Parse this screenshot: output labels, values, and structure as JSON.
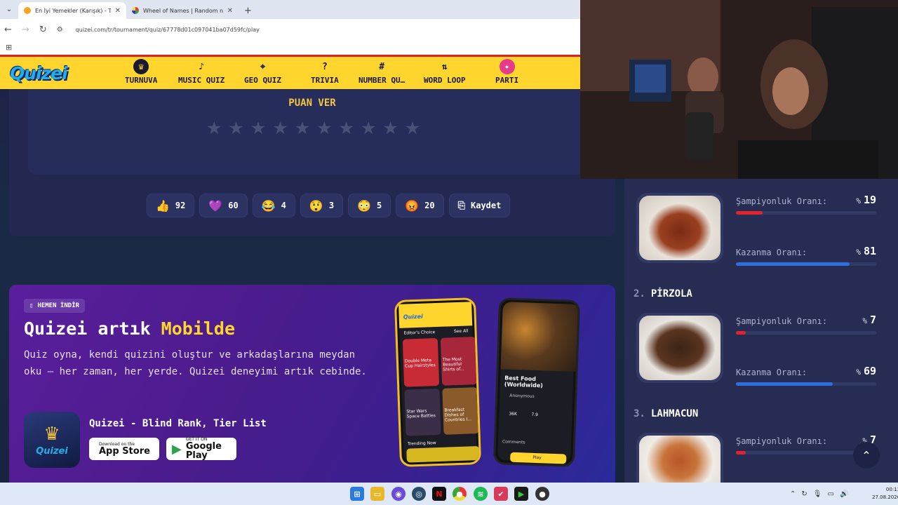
{
  "browser": {
    "tabs": [
      {
        "title": "En İyi Yemekler (Karışık) - Tier Li",
        "active": true
      },
      {
        "title": "Wheel of Names | Random nam",
        "active": false
      }
    ],
    "new_tab": "+",
    "url": "quizei.com/tr/tournament/quiz/67778d01c097041ba07d59fc/play"
  },
  "site": {
    "logo": "Quizei",
    "nav": [
      {
        "label": "TURNUVA",
        "icon": "trophy-icon"
      },
      {
        "label": "MUSIC QUIZ",
        "icon": "music-note-icon"
      },
      {
        "label": "GEO QUIZ",
        "icon": "map-pin-icon"
      },
      {
        "label": "TRIVIA",
        "icon": "question-icon"
      },
      {
        "label": "NUMBER QU…",
        "icon": "hash-icon"
      },
      {
        "label": "WORD LOOP",
        "icon": "sort-icon"
      },
      {
        "label": "PARTI",
        "icon": "party-icon"
      }
    ]
  },
  "rating": {
    "title": "PUAN VER",
    "star_count": 10,
    "selected": 0
  },
  "reactions": [
    {
      "emoji": "👍",
      "count": "92"
    },
    {
      "emoji": "💜",
      "count": "60"
    },
    {
      "emoji": "😂",
      "count": "4"
    },
    {
      "emoji": "😲",
      "count": "3"
    },
    {
      "emoji": "😳",
      "count": "5"
    },
    {
      "emoji": "😡",
      "count": "20"
    }
  ],
  "save_label": "Kaydet",
  "promo": {
    "badge": "HEMEN İNDİR",
    "title_prefix": "Quizei artık ",
    "title_highlight": "Mobilde",
    "description": "Quiz oyna, kendi quizini oluştur ve arkadaşlarına meydan oku — her zaman, her yerde. Quizei deneyimi artık cebinde.",
    "app_name": "Quizei - Blind Rank, Tier List",
    "app_icon_text": "Quizei",
    "app_store": {
      "line1": "Download on the",
      "line2": "App Store"
    },
    "google_play": {
      "line1": "GET IT ON",
      "line2": "Google Play"
    },
    "phone1": {
      "logo": "Quizei",
      "section": "Editor's Choice",
      "see_all": "See All",
      "items": [
        "Double Meta Cup Hairstyles",
        "The Most Beautiful Shirts of...",
        "Star Wars Space Battles",
        "Breakfast Dishes of Countries I..."
      ],
      "trending": "Trending Now"
    },
    "phone2": {
      "title": "Best Food (Worldwide)",
      "author": "Anonymous",
      "plays": "36K",
      "rating": "7.9",
      "comments": "Comments",
      "play": "Play"
    }
  },
  "list": {
    "labels": {
      "champion": "Şampiyonluk Oranı:",
      "win": "Kazanma Oranı:",
      "pct_sign": "%"
    },
    "entries": [
      {
        "rank": "",
        "name": "",
        "champion": 19,
        "win": 81
      },
      {
        "rank": "2.",
        "name": "PİRZOLA",
        "champion": 7,
        "win": 69
      },
      {
        "rank": "3.",
        "name": "LAHMACUN",
        "champion": 7,
        "win": null
      }
    ]
  },
  "taskbar": {
    "time": "00:13",
    "date": "27.08.2026"
  },
  "colors": {
    "accent_yellow": "#ffd52e",
    "champion_bar": "#e2232e",
    "win_bar": "#2f6ee0",
    "page_bg": "#1d2348"
  }
}
